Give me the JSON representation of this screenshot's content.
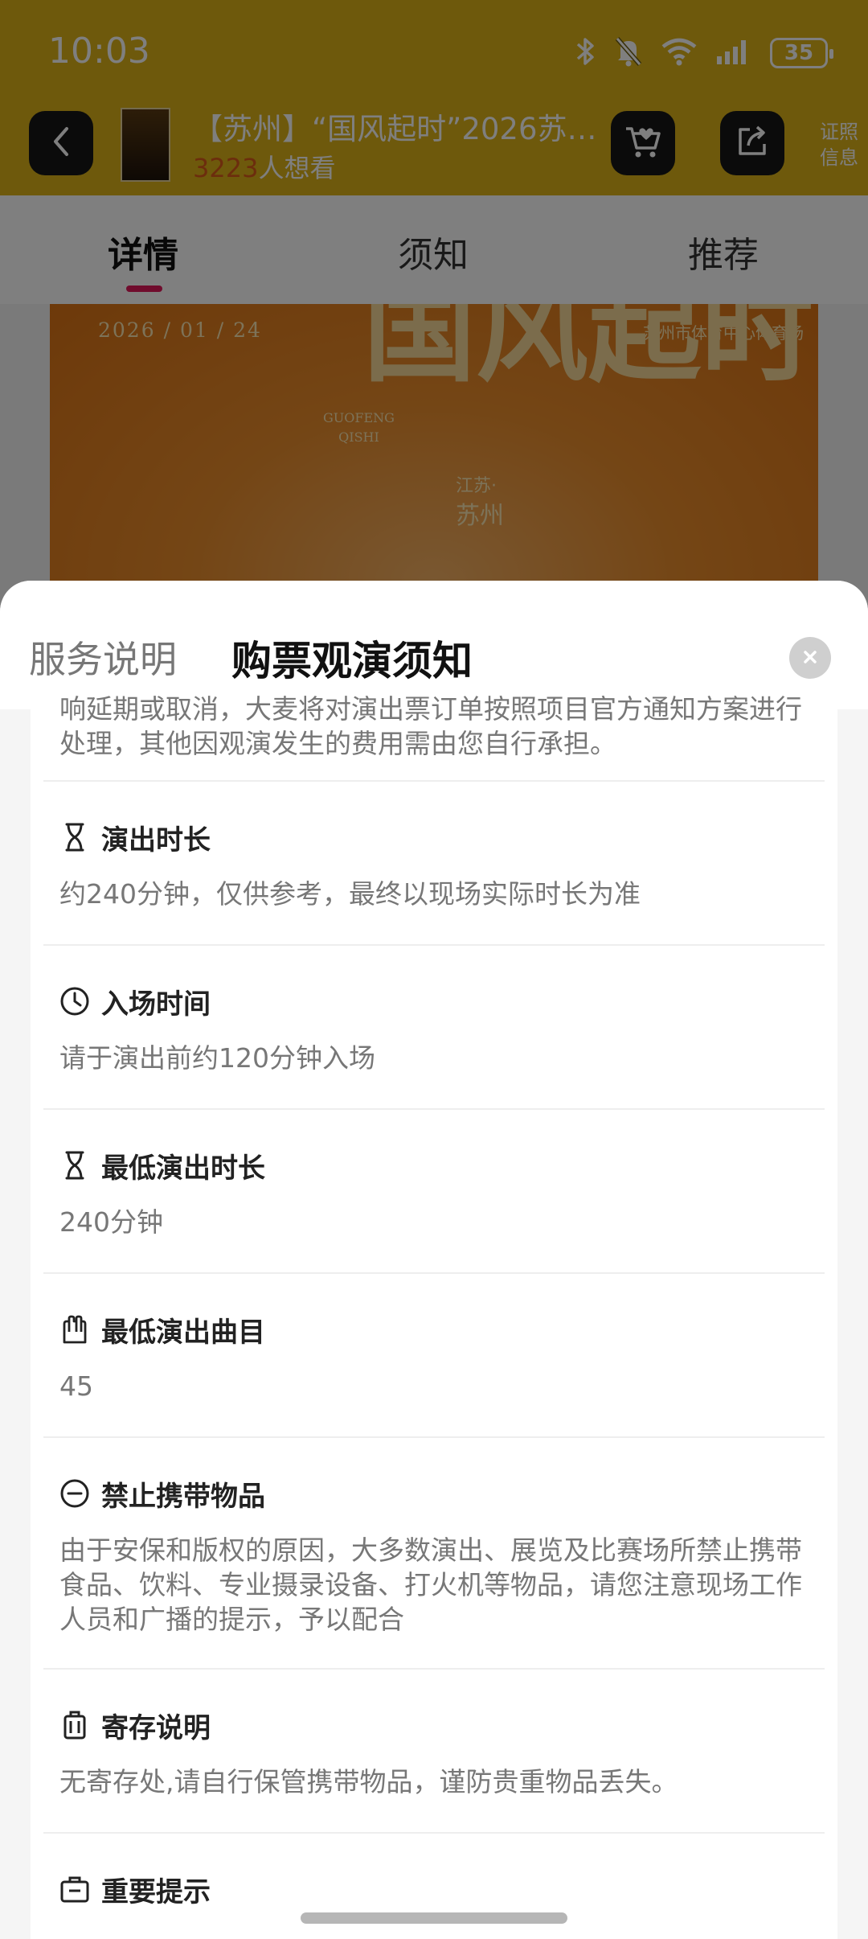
{
  "status_bar": {
    "time": "10:03",
    "battery": "35"
  },
  "navbar": {
    "title": "【苏州】“国风起时”2026苏…",
    "want_count": "3223",
    "want_suffix": "人想看",
    "cert_label": "证照信息"
  },
  "tabs": [
    {
      "label": "详情"
    },
    {
      "label": "须知"
    },
    {
      "label": "推荐"
    }
  ],
  "poster": {
    "date": "2026 / 01 / 24",
    "venue": "苏州市体育中心体育场",
    "calligraphy": "国风起时",
    "english": [
      "GUOFENG",
      "QISHI"
    ],
    "region1": "江苏·",
    "region2": "苏州"
  },
  "sheet": {
    "tab_service": "服务说明",
    "tab_notice": "购票观演须知",
    "intro": "响延期或取消，大麦将对演出票订单按照项目官方通知方案进行处理，其他因观演发生的费用需由您自行承担。",
    "sections": [
      {
        "icon": "hourglass-icon",
        "title": "演出时长",
        "body": "约240分钟，仅供参考，最终以现场实际时长为准"
      },
      {
        "icon": "clock-icon",
        "title": "入场时间",
        "body": "请于演出前约120分钟入场"
      },
      {
        "icon": "hourglass-icon",
        "title": "最低演出时长",
        "body": "240分钟"
      },
      {
        "icon": "hand-icon",
        "title": "最低演出曲目",
        "body": "45"
      },
      {
        "icon": "no-entry-icon",
        "title": "禁止携带物品",
        "body": "由于安保和版权的原因，大多数演出、展览及比赛场所禁止携带食品、饮料、专业摄录设备、打火机等物品，请您注意现场工作人员和广播的提示，予以配合"
      },
      {
        "icon": "luggage-icon",
        "title": "寄存说明",
        "body": "无寄存处,请自行保管携带物品，谨防贵重物品丢失。"
      },
      {
        "icon": "briefcase-icon",
        "title": "重要提示",
        "body": ""
      }
    ]
  }
}
